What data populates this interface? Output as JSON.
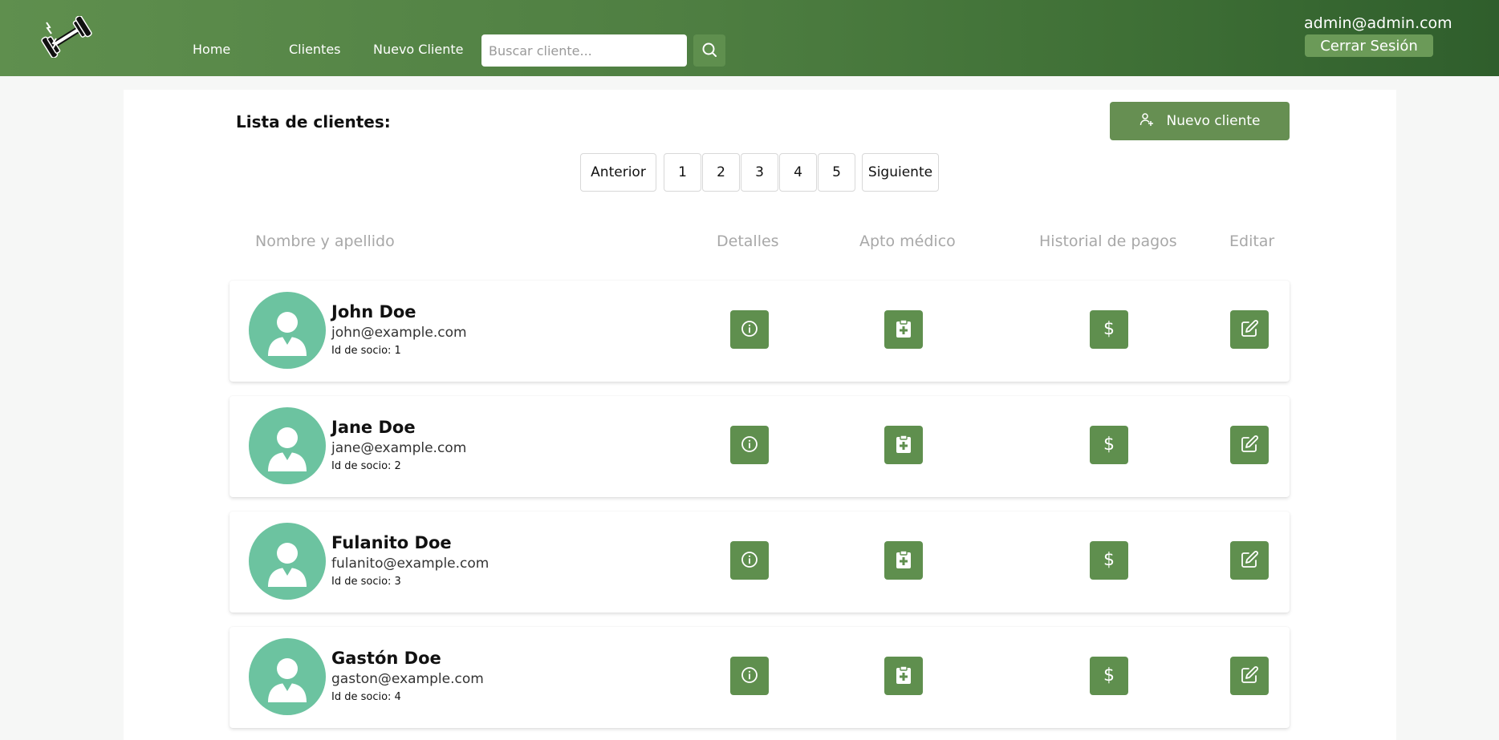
{
  "navbar": {
    "links": [
      {
        "label": "Home"
      },
      {
        "label": "Clientes"
      },
      {
        "label": "Nuevo Cliente"
      }
    ],
    "search": {
      "placeholder": "Buscar cliente...",
      "value": "",
      "icon": "search-icon"
    },
    "user_email": "admin@admin.com",
    "logout_label": "Cerrar Sesión"
  },
  "main": {
    "title": "Lista de clientes:",
    "new_client_label": "Nuevo cliente",
    "pagination": {
      "prev_label": "Anterior",
      "next_label": "Siguiente",
      "pages": [
        "1",
        "2",
        "3",
        "4",
        "5"
      ]
    },
    "columns": [
      "Nombre y apellido",
      "Detalles",
      "Apto médico",
      "Historial de pagos",
      "Editar"
    ],
    "clients": [
      {
        "name": "John Doe",
        "email": "john@example.com",
        "id_label": "Id de socio: 1"
      },
      {
        "name": "Jane Doe",
        "email": "jane@example.com",
        "id_label": "Id de socio: 2"
      },
      {
        "name": "Fulanito Doe",
        "email": "fulanito@example.com",
        "id_label": "Id de socio: 3"
      },
      {
        "name": "Gastón Doe",
        "email": "gaston@example.com",
        "id_label": "Id de socio: 4"
      }
    ]
  },
  "colors": {
    "navbar_start": "#5f8f4e",
    "navbar_end": "#2f5e2c",
    "accent": "#5f8f4e",
    "avatar": "#6cc3a0"
  }
}
